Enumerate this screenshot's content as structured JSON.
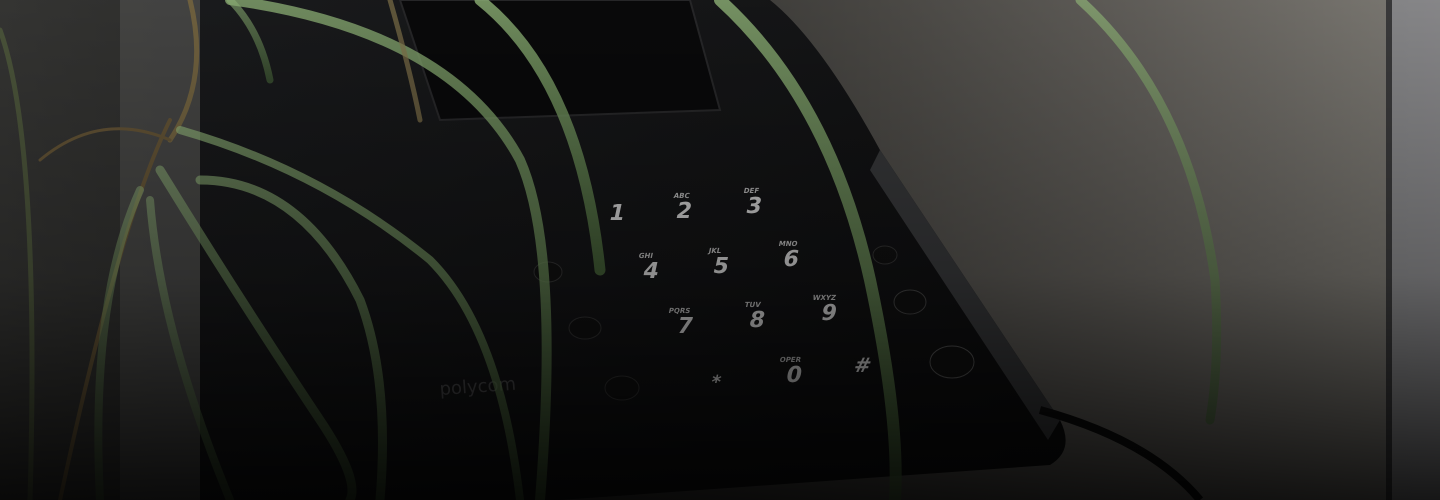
{
  "image": {
    "description_icon": "desk-phone-photo",
    "brand_text": "polycom",
    "keypad": [
      {
        "digit": "1",
        "letters": ""
      },
      {
        "digit": "2",
        "letters": "ABC"
      },
      {
        "digit": "3",
        "letters": "DEF"
      },
      {
        "digit": "4",
        "letters": "GHI"
      },
      {
        "digit": "5",
        "letters": "JKL"
      },
      {
        "digit": "6",
        "letters": "MNO"
      },
      {
        "digit": "7",
        "letters": "PQRS"
      },
      {
        "digit": "8",
        "letters": "TUV"
      },
      {
        "digit": "9",
        "letters": "WXYZ"
      },
      {
        "digit": "*",
        "letters": ""
      },
      {
        "digit": "0",
        "letters": "OPER"
      },
      {
        "digit": "#",
        "letters": ""
      }
    ],
    "colors": {
      "phone_body": "#151617",
      "key_text": "#d8d8d8",
      "leaf_green": "#7fa867",
      "wall": "#6b6863"
    }
  }
}
